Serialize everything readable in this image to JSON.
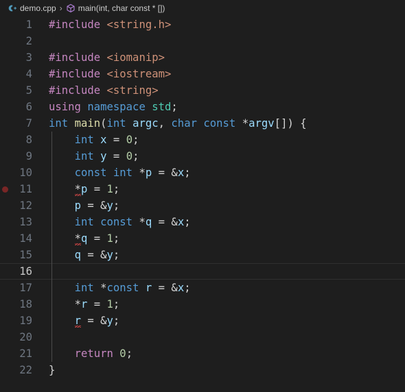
{
  "window": {
    "background": "#1e1e1e",
    "theme": "dark-plus"
  },
  "breadcrumb": {
    "file_icon": "cpp-file-icon",
    "file_icon_color": "#519aba",
    "file_label": "demo.cpp",
    "separator": "›",
    "symbol_icon": "symbol-namespace-cube-icon",
    "symbol_icon_color": "#b180d7",
    "symbol_label": "main(int, char const * [])"
  },
  "editor": {
    "active_line": 16,
    "breakpoint_lines": [
      11
    ],
    "colors": {
      "background": "#1e1e1e",
      "line_number": "#6e7681",
      "active_line_number": "#c6c6c6",
      "indent_guide": "#4b4b4b",
      "breakpoint": "#792626",
      "error_squiggle": "#f14c4c",
      "preprocessor": "#c586c0",
      "string": "#ce9178",
      "keyword": "#569cd6",
      "function": "#dcdcaa",
      "variable": "#9cdcfe",
      "namespace": "#4ec9b0",
      "number": "#b5cea8",
      "text": "#d4d4d4"
    },
    "lines": [
      {
        "n": "1",
        "text": "#include <string.h>"
      },
      {
        "n": "2",
        "text": ""
      },
      {
        "n": "3",
        "text": "#include <iomanip>"
      },
      {
        "n": "4",
        "text": "#include <iostream>"
      },
      {
        "n": "5",
        "text": "#include <string>"
      },
      {
        "n": "6",
        "text": "using namespace std;"
      },
      {
        "n": "7",
        "text": "int main(int argc, char const *argv[]) {"
      },
      {
        "n": "8",
        "text": "    int x = 0;"
      },
      {
        "n": "9",
        "text": "    int y = 0;"
      },
      {
        "n": "10",
        "text": "    const int *p = &x;"
      },
      {
        "n": "11",
        "text": "    *p = 1;"
      },
      {
        "n": "12",
        "text": "    p = &y;"
      },
      {
        "n": "13",
        "text": "    int const *q = &x;"
      },
      {
        "n": "14",
        "text": "    *q = 1;"
      },
      {
        "n": "15",
        "text": "    q = &y;"
      },
      {
        "n": "16",
        "text": ""
      },
      {
        "n": "17",
        "text": "    int *const r = &x;"
      },
      {
        "n": "18",
        "text": "    *r = 1;"
      },
      {
        "n": "19",
        "text": "    r = &y;"
      },
      {
        "n": "20",
        "text": ""
      },
      {
        "n": "21",
        "text": "    return 0;"
      },
      {
        "n": "22",
        "text": "}"
      }
    ]
  }
}
